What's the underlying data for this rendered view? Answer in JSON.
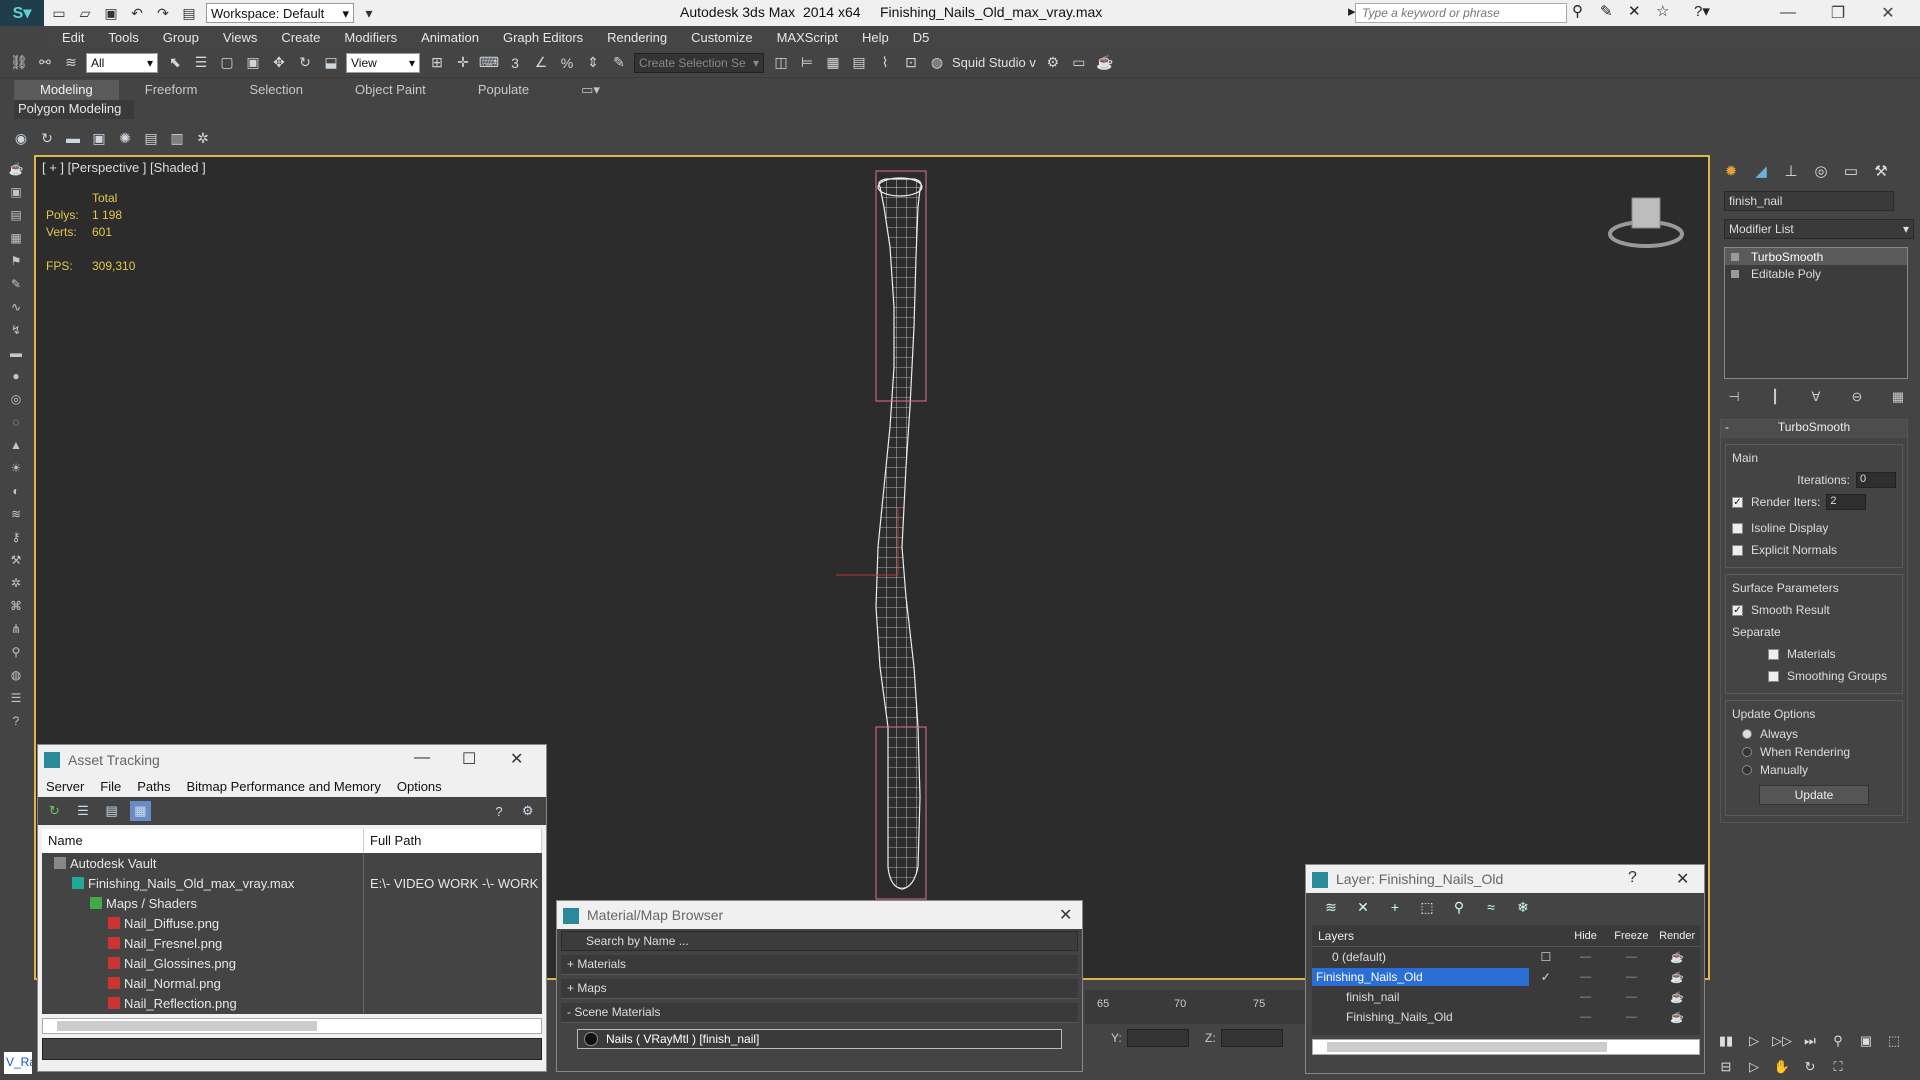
{
  "titlebar": {
    "app_title": "Autodesk 3ds Max  2014 x64     Finishing_Nails_Old_max_vray.max",
    "workspace": "Workspace: Default",
    "search_placeholder": "Type a keyword or phrase"
  },
  "menu": [
    "Edit",
    "Tools",
    "Group",
    "Views",
    "Create",
    "Modifiers",
    "Animation",
    "Graph Editors",
    "Rendering",
    "Customize",
    "MAXScript",
    "Help",
    "D5"
  ],
  "toolbar": {
    "filter": "All",
    "ref_coord": "View",
    "selection_set_placeholder": "Create Selection Se",
    "squid_label": "Squid Studio v"
  },
  "ribbon": {
    "tabs": [
      "Modeling",
      "Freeform",
      "Selection",
      "Object Paint",
      "Populate"
    ],
    "panel": "Polygon Modeling"
  },
  "viewport": {
    "label": "[ + ] [Perspective ] [Shaded ]",
    "total_label": "Total",
    "polys_label": "Polys:",
    "polys": "1 198",
    "verts_label": "Verts:",
    "verts": "601",
    "fps_label": "FPS:",
    "fps": "309,310",
    "axis_y": "y"
  },
  "command_panel": {
    "object_name": "finish_nail",
    "modifier_list": "Modifier List",
    "stack": [
      "TurboSmooth",
      "Editable Poly"
    ],
    "rollout_title": "TurboSmooth",
    "main_label": "Main",
    "iterations_label": "Iterations:",
    "iterations": "0",
    "render_iters_label": "Render Iters:",
    "render_iters": "2",
    "isoline": "Isoline Display",
    "explicit_normals": "Explicit Normals",
    "surface_params": "Surface Parameters",
    "smooth_result": "Smooth Result",
    "separate": "Separate",
    "materials": "Materials",
    "smoothing_groups": "Smoothing Groups",
    "update_options": "Update Options",
    "always": "Always",
    "when_rendering": "When Rendering",
    "manually": "Manually",
    "update_button": "Update"
  },
  "asset_tracking": {
    "title": "Asset Tracking",
    "menu": [
      "Server",
      "File",
      "Paths",
      "Bitmap Performance and Memory",
      "Options"
    ],
    "columns": [
      "Name",
      "Full Path"
    ],
    "rows": [
      {
        "name": "Autodesk Vault",
        "path": "",
        "indent": 0,
        "icon": "vault-icon"
      },
      {
        "name": "Finishing_Nails_Old_max_vray.max",
        "path": "E:\\- VIDEO WORK -\\- WORK",
        "indent": 1,
        "icon": "max-file-icon"
      },
      {
        "name": "Maps / Shaders",
        "path": "",
        "indent": 2,
        "icon": "maps-icon"
      },
      {
        "name": "Nail_Diffuse.png",
        "path": "",
        "indent": 3,
        "icon": "png-icon"
      },
      {
        "name": "Nail_Fresnel.png",
        "path": "",
        "indent": 3,
        "icon": "png-icon"
      },
      {
        "name": "Nail_Glossines.png",
        "path": "",
        "indent": 3,
        "icon": "png-icon"
      },
      {
        "name": "Nail_Normal.png",
        "path": "",
        "indent": 3,
        "icon": "png-icon"
      },
      {
        "name": "Nail_Reflection.png",
        "path": "",
        "indent": 3,
        "icon": "png-icon"
      }
    ]
  },
  "material_browser": {
    "title": "Material/Map Browser",
    "search_placeholder": "Search by Name ...",
    "sections": [
      "+ Materials",
      "+ Maps",
      "- Scene Materials"
    ],
    "material": "Nails  ( VRayMtl )  [finish_nail]"
  },
  "timeline": {
    "ticks": [
      "65",
      "70",
      "75"
    ],
    "y_label": "Y:",
    "z_label": "Z:"
  },
  "layer_window": {
    "title": "Layer: Finishing_Nails_Old",
    "columns": [
      "Layers",
      "Hide",
      "Freeze",
      "Render"
    ],
    "rows": [
      {
        "name": "0 (default)",
        "selected": false
      },
      {
        "name": "Finishing_Nails_Old",
        "selected": true
      },
      {
        "name": "finish_nail",
        "selected": false
      },
      {
        "name": "Finishing_Nails_Old",
        "selected": false
      }
    ]
  },
  "script_label": "V_Ra",
  "colors": {
    "viewport_border": "#e0b64a",
    "stats": "#e6c84a",
    "layer_selected": "#2b6fd6"
  }
}
